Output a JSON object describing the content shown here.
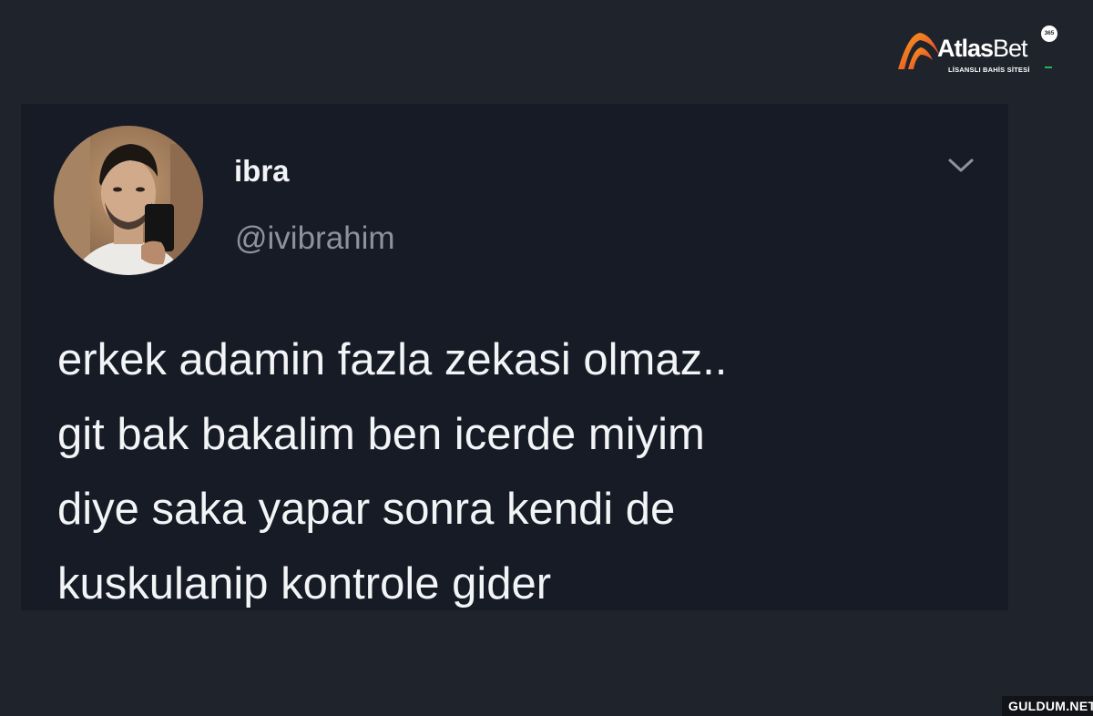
{
  "brand": {
    "name_bold": "Atlas",
    "name_regular": "Bet",
    "tagline": "LİSANSLI BAHİS SİTESİ",
    "badge": "365",
    "icon": "atlasbet-logo-icon",
    "colors": {
      "logo_gradient_start": "#f7a21b",
      "logo_gradient_end": "#e5322d"
    }
  },
  "tweet": {
    "display_name": "ibra",
    "handle": "@ivibrahim",
    "menu_icon": "chevron-down-icon",
    "avatar_icon": "profile-photo",
    "lines": [
      "erkek adamin fazla zekasi olmaz..",
      "git bak bakalim ben icerde miyim",
      "diye saka yapar sonra kendi de",
      "kuskulanip kontrole gider"
    ]
  },
  "watermark": {
    "text": "GULDUM.NET"
  },
  "colors": {
    "page_background": "#1f232b",
    "card_background": "#161b26",
    "text_primary": "#f3f4f6",
    "text_secondary": "#8c939c"
  }
}
